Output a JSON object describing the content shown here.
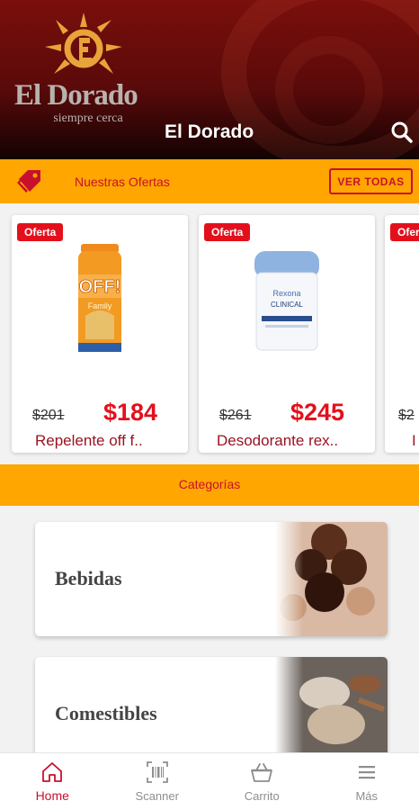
{
  "header": {
    "logo_name": "El Dorado",
    "logo_tagline": "siempre cerca",
    "title": "El Dorado",
    "search_icon": "search-icon"
  },
  "offers": {
    "label": "Nuestras Ofertas",
    "button": "VER TODAS",
    "products": [
      {
        "badge": "Oferta",
        "old_price": "$201",
        "new_price": "$184",
        "name": "Repelente off f.."
      },
      {
        "badge": "Oferta",
        "old_price": "$261",
        "new_price": "$245",
        "name": "Desodorante rex.."
      },
      {
        "badge": "Oferta",
        "old_price": "$2",
        "name": "I"
      }
    ]
  },
  "categories": {
    "label": "Categorías",
    "items": [
      {
        "name": "Bebidas"
      },
      {
        "name": "Comestibles"
      }
    ]
  },
  "bottom_nav": [
    {
      "label": "Home",
      "icon": "home-icon",
      "active": true
    },
    {
      "label": "Scanner",
      "icon": "barcode-scanner-icon"
    },
    {
      "label": "Carrito",
      "icon": "basket-icon"
    },
    {
      "label": "Más",
      "icon": "menu-icon"
    }
  ],
  "colors": {
    "brand_red": "#c8102e",
    "offer_red": "#e3101c",
    "accent_orange": "#ffa600",
    "header_dark": "#5a0a0a"
  }
}
